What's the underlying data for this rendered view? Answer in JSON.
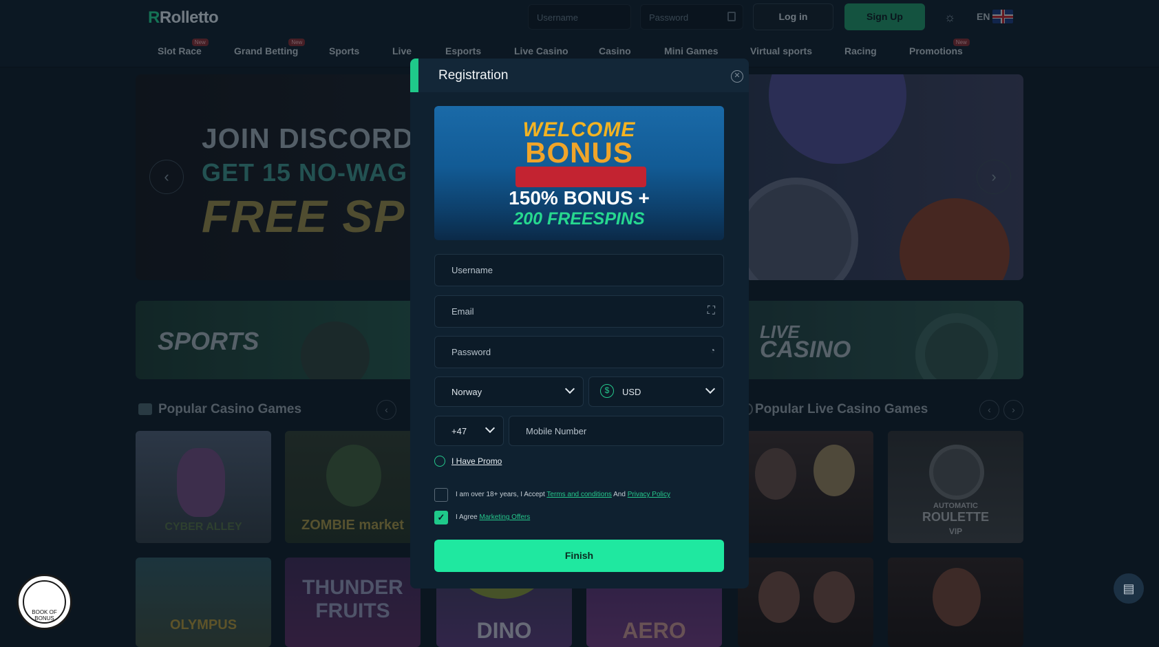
{
  "brand": {
    "logo": "Rolletto"
  },
  "header": {
    "username_placeholder": "Username",
    "password_placeholder": "Password",
    "login_label": "Log in",
    "signup_label": "Sign Up",
    "lang": "EN"
  },
  "nav": {
    "items": [
      {
        "label": "Slot Race",
        "badge": "New"
      },
      {
        "label": "Grand Betting",
        "badge": "New"
      },
      {
        "label": "Sports"
      },
      {
        "label": "Live"
      },
      {
        "label": "Esports"
      },
      {
        "label": "Live Casino"
      },
      {
        "label": "Casino"
      },
      {
        "label": "Mini Games"
      },
      {
        "label": "Virtual sports"
      },
      {
        "label": "Racing"
      },
      {
        "label": "Promotions",
        "badge": "New"
      }
    ]
  },
  "banner": {
    "line1": "JOIN DISCORD",
    "line2": "GET 15 NO-WAG",
    "line3": "FREE SP"
  },
  "tiles": {
    "sports": "SPORTS",
    "live_casino_1": "LIVE",
    "live_casino_2": "CASINO"
  },
  "sections": {
    "casino": "Popular Casino Games",
    "live_casino": "Popular Live Casino Games"
  },
  "thumbs": {
    "t1": "CYBER ALLEY",
    "t2": "ZOMBIE market",
    "t3": "OLYMPUS",
    "t4": "THUNDER FRUITS",
    "t5": "DINO",
    "t6": "AERO",
    "roulette_1": "AUTOMATIC",
    "roulette_2": "ROULETTE",
    "roulette_3": "VIP"
  },
  "modal": {
    "title": "Registration",
    "promo": {
      "welcome": "WELCOME",
      "bonus": "BONUS",
      "percent": "150% BONUS +",
      "freespins": "200 FREESPINS"
    },
    "username_placeholder": "Username",
    "email_placeholder": "Email",
    "password_placeholder": "Password",
    "country": "Norway",
    "currency": "USD",
    "phone_code": "+47",
    "mobile_placeholder": "Mobile Number",
    "promo_link": "I Have Promo",
    "age_text": "I am over 18+ years, I Accept",
    "terms_link": "Terms and conditions",
    "and": "And",
    "privacy_link": "Privacy Policy",
    "agree_text": "I Agree",
    "marketing_link": "Marketing Offers",
    "finish_label": "Finish",
    "checkbox_age_checked": false,
    "checkbox_marketing_checked": true
  },
  "badge_bob": "BOOK OF BONUS",
  "colors": {
    "accent": "#1fc98a",
    "finish": "#1fe8a0",
    "bg": "#0f1e2b"
  }
}
